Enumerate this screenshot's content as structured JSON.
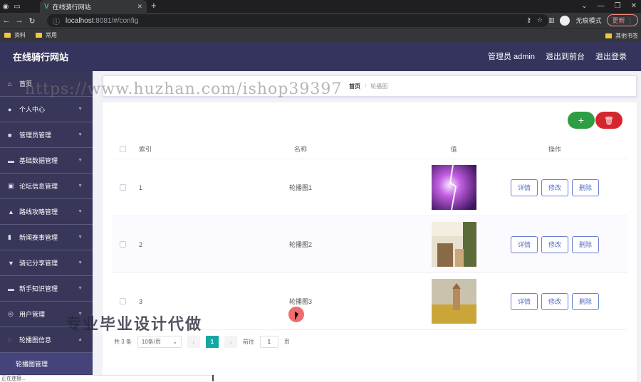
{
  "browser": {
    "tab_title": "在线骑行网站",
    "url_host": "localhost",
    "url_path": ":8081/#/config",
    "profile_label": "无痕模式",
    "update_label": "更新",
    "bookmarks": [
      "资料",
      "常用"
    ],
    "other_bookmarks": "其他书签",
    "status_text": "正在连接..."
  },
  "header": {
    "site_title": "在线骑行网站",
    "admin_label": "管理员 admin",
    "front_label": "退出到前台",
    "logout_label": "退出登录"
  },
  "sidebar": {
    "items": [
      {
        "label": "首页",
        "icon": "home-icon",
        "glyph": "⌂",
        "chevron": false
      },
      {
        "label": "个人中心",
        "icon": "user-icon",
        "glyph": "●",
        "chevron": true
      },
      {
        "label": "管理员管理",
        "icon": "admin-icon",
        "glyph": "■",
        "chevron": true
      },
      {
        "label": "基础数据管理",
        "icon": "data-icon",
        "glyph": "▬",
        "chevron": true
      },
      {
        "label": "论坛信息管理",
        "icon": "forum-icon",
        "glyph": "▣",
        "chevron": true
      },
      {
        "label": "路线攻略管理",
        "icon": "route-icon",
        "glyph": "▲",
        "chevron": true
      },
      {
        "label": "新闻赛事管理",
        "icon": "news-icon",
        "glyph": "▮",
        "chevron": true
      },
      {
        "label": "骑记分享管理",
        "icon": "share-icon",
        "glyph": "▼",
        "chevron": true
      },
      {
        "label": "新手知识管理",
        "icon": "knowledge-icon",
        "glyph": "▬",
        "chevron": true
      },
      {
        "label": "用户管理",
        "icon": "users-icon",
        "glyph": "◎",
        "chevron": true
      },
      {
        "label": "轮播图信息",
        "icon": "carousel-icon",
        "glyph": "◌",
        "chevron": true
      }
    ],
    "sub_item": "轮播图管理"
  },
  "breadcrumb": {
    "home": "首页",
    "current": "轮播图"
  },
  "table": {
    "headers": {
      "index": "索引",
      "name": "名称",
      "value": "值",
      "ops": "操作"
    },
    "rows": [
      {
        "index": "1",
        "name": "轮播图1"
      },
      {
        "index": "2",
        "name": "轮播图2"
      },
      {
        "index": "3",
        "name": "轮播图3"
      }
    ],
    "actions": {
      "detail": "详情",
      "edit": "修改",
      "delete": "删除"
    }
  },
  "pagination": {
    "total": "共 3 条",
    "page_size": "10条/页",
    "current_page": "1",
    "goto_label": "前往",
    "goto_value": "1",
    "page_suffix": "页"
  },
  "overlays": {
    "watermark": "https://www.huzhan.com/ishop39397",
    "promo": "专业毕业设计代做"
  },
  "colors": {
    "header_bg": "#35345c",
    "sidebar_bg": "#38375a",
    "add_button": "#2e9e45",
    "delete_button": "#d5262d",
    "pager_active": "#13a8a0"
  }
}
